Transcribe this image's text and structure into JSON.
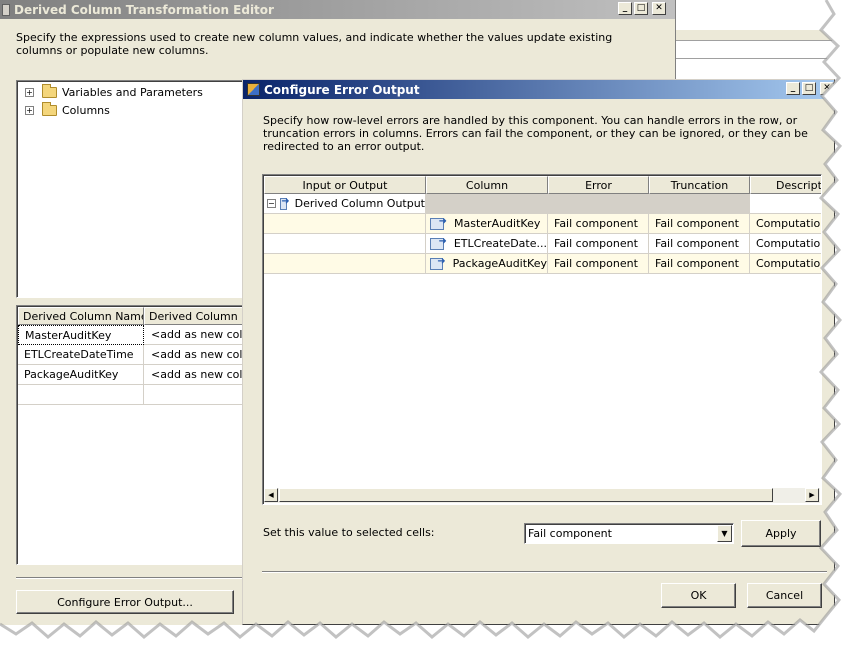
{
  "main_window": {
    "title": "Derived Column Transformation Editor",
    "description": "Specify the expressions used to create new column values, and indicate whether the values update existing columns or populate new columns.",
    "tree_items": [
      "Variables and Parameters",
      "Columns"
    ],
    "grid_headers": [
      "Derived Column Name",
      "Derived Column"
    ],
    "grid_rows": [
      {
        "name": "MasterAuditKey",
        "derived": "<add as new column>"
      },
      {
        "name": "ETLCreateDateTime",
        "derived": "<add as new column>"
      },
      {
        "name": "PackageAuditKey",
        "derived": "<add as new column>"
      }
    ],
    "configure_button": "Configure Error Output..."
  },
  "dialog": {
    "title": "Configure Error Output",
    "description": "Specify how row-level errors are handled by this component. You can handle errors in the row, or truncation errors in columns. Errors can fail the component, or they can be ignored, or they can be redirected to an error output.",
    "headers": [
      "Input or Output",
      "Column",
      "Error",
      "Truncation",
      "Description"
    ],
    "output_name": "Derived Column Output",
    "rows": [
      {
        "column": "MasterAuditKey",
        "error": "Fail component",
        "truncation": "Fail component",
        "description": "Computation"
      },
      {
        "column": "ETLCreateDate...",
        "error": "Fail component",
        "truncation": "Fail component",
        "description": "Computation"
      },
      {
        "column": "PackageAuditKey",
        "error": "Fail component",
        "truncation": "Fail component",
        "description": "Computation"
      }
    ],
    "set_value_label": "Set this value to selected cells:",
    "set_value_selected": "Fail component",
    "apply_label": "Apply",
    "ok_label": "OK",
    "cancel_label": "Cancel"
  },
  "colors": {
    "active_title": "#0a246a",
    "inactive_title": "#808080",
    "dialog_bg": "#ece9d8",
    "selected_row": "#fffbe6"
  }
}
